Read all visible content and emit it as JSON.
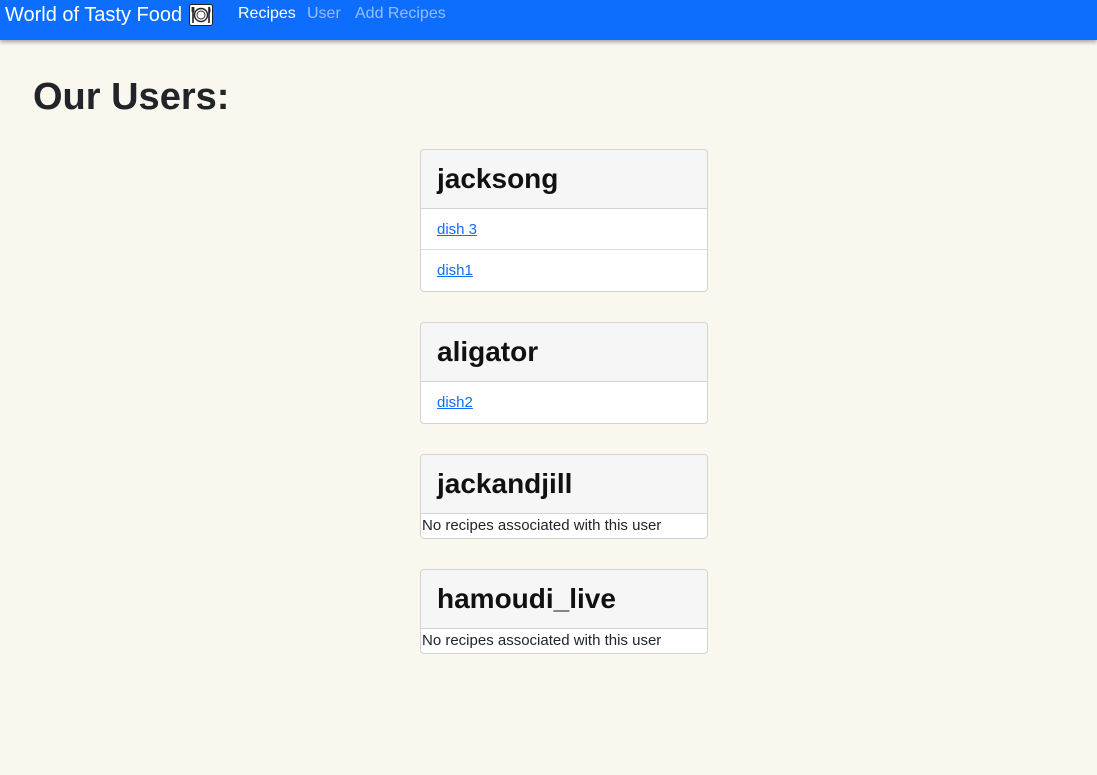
{
  "navbar": {
    "brand": "World of Tasty Food",
    "brand_icon": "plate-utensils-icon",
    "links": [
      "Recipes",
      "User",
      "Add Recipes"
    ],
    "active_link": "Recipes",
    "background": "#0d6efd"
  },
  "page": {
    "title": "Our Users:",
    "background": "#f9f7ee"
  },
  "users": [
    {
      "name": "jacksong",
      "recipes": [
        "dish 3",
        "dish1"
      ]
    },
    {
      "name": "aligator",
      "recipes": [
        "dish2"
      ]
    },
    {
      "name": "jackandjill",
      "recipes": []
    },
    {
      "name": "hamoudi_live",
      "recipes": []
    }
  ],
  "empty_message": "No recipes associated with this user",
  "colors": {
    "link": "#0d6efd",
    "card_header": "#f6f6f6"
  }
}
